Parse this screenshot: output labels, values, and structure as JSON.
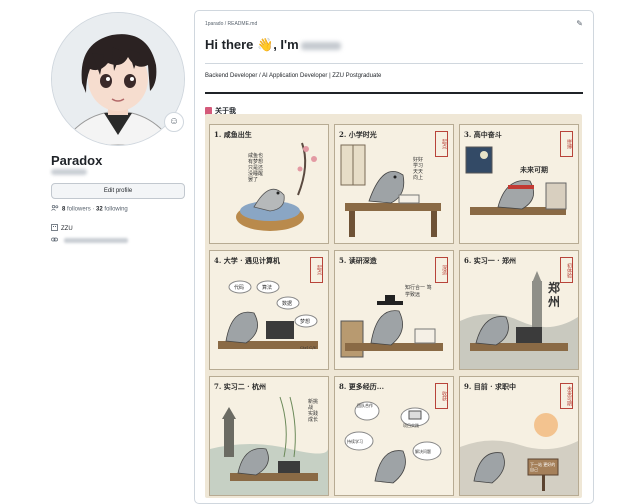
{
  "profile": {
    "display_name": "Paradox",
    "edit_button": "Edit profile",
    "followers_count": "8",
    "followers_label": "followers",
    "separator": "·",
    "following_count": "32",
    "following_label": "following",
    "organization": "ZZU",
    "status_icon": "smiley-icon"
  },
  "readme": {
    "path": "1parado / README.md",
    "title_prefix": "Hi there 👋, I'm",
    "subtitle": "Backend Developer / AI Application Developer | ZZU Postgraduate",
    "about_heading": "关于我"
  },
  "comic": {
    "panels": [
      {
        "title": "1. 咸鱼出生",
        "text": "咸鱼也有梦想 只是还没睡醒罢了"
      },
      {
        "title": "2. 小学时光",
        "text": "好好学习 天天向上",
        "seal": "起点"
      },
      {
        "title": "3. 高中奋斗",
        "text": "未来可期",
        "seal": "拼搏"
      },
      {
        "title": "4. 大学 · 遇见计算机",
        "text": [
          "代码",
          "算法",
          "数据",
          "梦想"
        ],
        "seal": "起点",
        "extra": "Ctrl C/V"
      },
      {
        "title": "5. 读研深造",
        "text": "知行合一 笃学致远",
        "seal": "深造"
      },
      {
        "title": "6. 实习一 · 郑州",
        "text": "郑州",
        "seal": "初体验"
      },
      {
        "title": "7. 实习二 · 杭州",
        "text": "新挑战 实践成长"
      },
      {
        "title": "8. 更多经历...",
        "text": [
          "团队合作",
          "项目实践",
          "持续学习",
          "解决问题"
        ],
        "seal": "收获"
      },
      {
        "title": "9. 目前 · 求职中",
        "text": "下一站 更好的自己",
        "seal": "未来可期"
      }
    ]
  }
}
